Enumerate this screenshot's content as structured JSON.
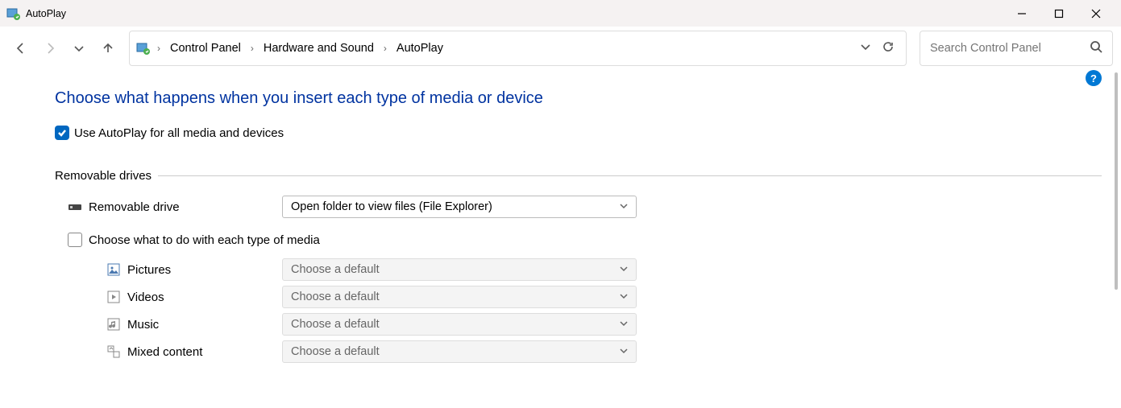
{
  "window": {
    "title": "AutoPlay"
  },
  "breadcrumbs": {
    "item0": "Control Panel",
    "item1": "Hardware and Sound",
    "item2": "AutoPlay"
  },
  "search": {
    "placeholder": "Search Control Panel"
  },
  "page": {
    "heading": "Choose what happens when you insert each type of media or device",
    "help_tooltip": "?",
    "global_check_label": "Use AutoPlay for all media and devices",
    "group_removable": "Removable drives",
    "removable_drive_label": "Removable drive",
    "removable_drive_value": "Open folder to view files (File Explorer)",
    "subcheck_label": "Choose what to do with each type of media",
    "default_placeholder": "Choose a default",
    "media": {
      "pictures": "Pictures",
      "videos": "Videos",
      "music": "Music",
      "mixed": "Mixed content"
    }
  }
}
